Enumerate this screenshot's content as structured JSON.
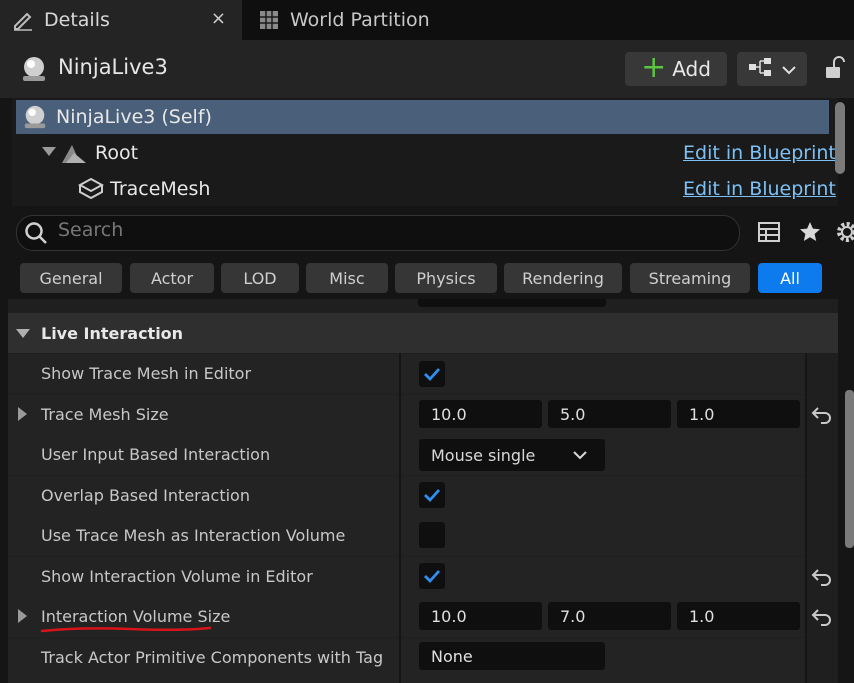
{
  "tabs": [
    {
      "label": "Details",
      "close": "×",
      "active": true
    },
    {
      "label": "World Partition",
      "active": false
    }
  ],
  "header": {
    "title": "NinjaLive3",
    "add_label": "Add"
  },
  "tree": [
    {
      "label": "NinjaLive3 (Self)",
      "selected": true
    },
    {
      "label": "Root",
      "link": "Edit in Blueprint"
    },
    {
      "label": "TraceMesh",
      "link": "Edit in Blueprint"
    }
  ],
  "search": {
    "placeholder": "Search"
  },
  "filters": [
    "General",
    "Actor",
    "LOD",
    "Misc",
    "Physics",
    "Rendering",
    "Streaming",
    "All"
  ],
  "filter_selected": "All",
  "category": {
    "label": "Live Interaction"
  },
  "properties": [
    {
      "label": "Show Trace Mesh in Editor",
      "type": "checkbox",
      "checked": true
    },
    {
      "label": "Trace Mesh Size",
      "type": "vector",
      "values": [
        "10.0",
        "5.0",
        "1.0"
      ]
    },
    {
      "label": "User Input Based Interaction",
      "type": "combo",
      "value": "Mouse single"
    },
    {
      "label": "Overlap Based Interaction",
      "type": "checkbox",
      "checked": true
    },
    {
      "label": "Use Trace Mesh as Interaction Volume",
      "type": "checkbox",
      "checked": false
    },
    {
      "label": "Show Interaction Volume in Editor",
      "type": "checkbox",
      "checked": true
    },
    {
      "label": "Interaction Volume Size",
      "type": "vector",
      "values": [
        "10.0",
        "7.0",
        "1.0"
      ]
    },
    {
      "label": "Track Actor Primitive Components with Tag",
      "type": "text",
      "value": "None"
    }
  ],
  "colors": {
    "accent": "#0d7aed",
    "link": "#7cc0f5",
    "selection": "#4a607a",
    "annotation": "#d8141a"
  }
}
